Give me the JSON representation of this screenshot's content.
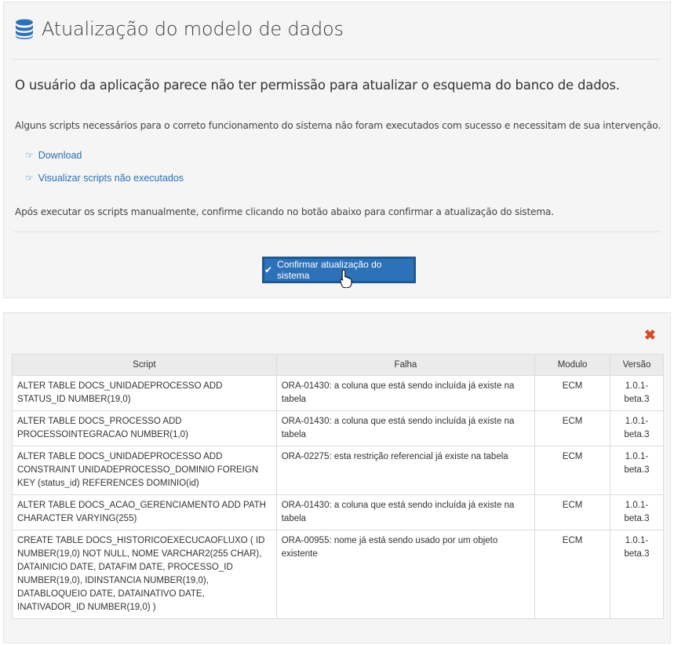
{
  "header": {
    "icon": "database-icon",
    "title": "Atualização do modelo de dados"
  },
  "message": {
    "headline": "O usuário da aplicação parece não ter permissão para atualizar o esquema do banco de dados.",
    "description": "Alguns scripts necessários para o correto funcionamento do sistema não foram executados com sucesso e necessitam de sua intervenção.",
    "instructions": "Após executar os scripts manualmente, confirme clicando no botão abaixo para confirmar a atualização do sistema."
  },
  "links": [
    {
      "icon": "hand-pointer-icon",
      "label": "Download"
    },
    {
      "icon": "hand-pointer-icon",
      "label": "Visualizar scripts não executados"
    }
  ],
  "confirm_button": {
    "icon": "check-icon",
    "label": "Confirmar atualização do sistema"
  },
  "colors": {
    "primary": "#2d72b8",
    "link": "#2a6fb3",
    "close": "#d64b2a"
  },
  "scripts_table": {
    "close_icon": "close-icon",
    "columns": [
      "Script",
      "Falha",
      "Modulo",
      "Versão"
    ],
    "rows": [
      {
        "script": "ALTER TABLE DOCS_UNIDADEPROCESSO ADD STATUS_ID NUMBER(19,0)",
        "falha": "ORA-01430: a coluna que está sendo incluída já existe na tabela",
        "modulo": "ECM",
        "versao": "1.0.1-beta.3"
      },
      {
        "script": "ALTER TABLE DOCS_PROCESSO ADD PROCESSOINTEGRACAO NUMBER(1,0)",
        "falha": "ORA-01430: a coluna que está sendo incluída já existe na tabela",
        "modulo": "ECM",
        "versao": "1.0.1-beta.3"
      },
      {
        "script": "ALTER TABLE DOCS_UNIDADEPROCESSO ADD CONSTRAINT UNIDADEPROCESSO_DOMINIO FOREIGN KEY (status_id) REFERENCES DOMINIO(id)",
        "falha": "ORA-02275: esta restrição referencial já existe na tabela",
        "modulo": "ECM",
        "versao": "1.0.1-beta.3"
      },
      {
        "script": "ALTER TABLE DOCS_ACAO_GERENCIAMENTO ADD PATH CHARACTER VARYING(255)",
        "falha": "ORA-01430: a coluna que está sendo incluída já existe na tabela",
        "modulo": "ECM",
        "versao": "1.0.1-beta.3"
      },
      {
        "script": "CREATE TABLE DOCS_HISTORICOEXECUCAOFLUXO ( ID NUMBER(19,0) NOT NULL, NOME VARCHAR2(255 CHAR), DATAINICIO DATE, DATAFIM DATE, PROCESSO_ID NUMBER(19,0), IDINSTANCIA NUMBER(19,0), DATABLOQUEIO DATE, DATAINATIVO DATE, INATIVADOR_ID NUMBER(19,0) )",
        "falha": "ORA-00955: nome já está sendo usado por um objeto existente",
        "modulo": "ECM",
        "versao": "1.0.1-beta.3"
      }
    ]
  }
}
